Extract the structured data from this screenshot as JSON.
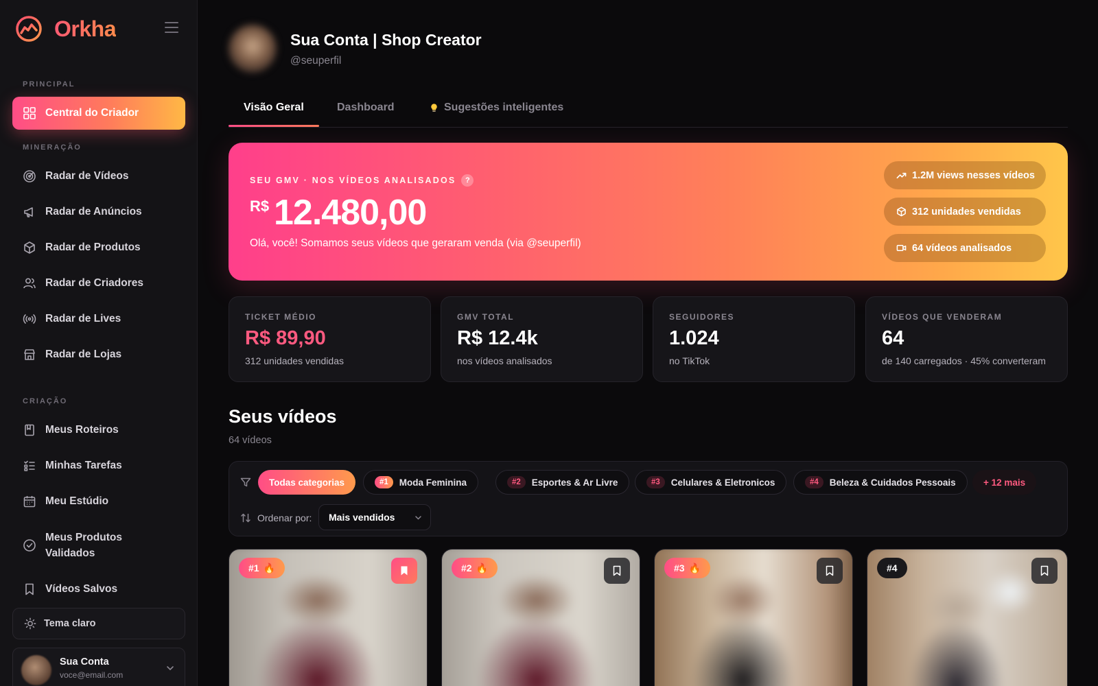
{
  "brand": {
    "name": "Orkha",
    "icon": "orkha-logo-icon"
  },
  "sidebar": {
    "sections": {
      "principal": "PRINCIPAL",
      "mineracao": "MINERAÇÃO",
      "criacao": "CRIAÇÃO"
    },
    "items": [
      {
        "label": "Central do Criador",
        "icon": "grid-icon",
        "active": true
      },
      {
        "label": "Radar de Vídeos",
        "icon": "radar-icon"
      },
      {
        "label": "Radar de Anúncios",
        "icon": "megaphone-icon"
      },
      {
        "label": "Radar de Produtos",
        "icon": "box-icon"
      },
      {
        "label": "Radar de Criadores",
        "icon": "users-icon"
      },
      {
        "label": "Radar de Lives",
        "icon": "broadcast-icon"
      },
      {
        "label": "Radar de Lojas",
        "icon": "store-icon"
      },
      {
        "label": "Meus Roteiros",
        "icon": "book-icon"
      },
      {
        "label": "Minhas Tarefas",
        "icon": "checklist-icon"
      },
      {
        "label": "Meu Estúdio",
        "icon": "calendar-icon"
      },
      {
        "label": "Meus Produtos Validados",
        "icon": "check-circle-icon"
      },
      {
        "label": "Vídeos Salvos",
        "icon": "bookmark-icon"
      }
    ],
    "theme_toggle": "Tema claro",
    "account": {
      "name": "Sua Conta",
      "email": "voce@email.com"
    }
  },
  "profile": {
    "name": "Sua Conta | Shop Creator",
    "handle": "@seuperfil"
  },
  "tabs": [
    {
      "label": "Visão Geral",
      "active": true
    },
    {
      "label": "Dashboard"
    },
    {
      "label": "Sugestões inteligentes",
      "icon": "lightbulb-icon"
    }
  ],
  "hero": {
    "kicker": "SEU GMV · NOS VÍDEOS ANALISADOS",
    "help": "?",
    "currency": "R$",
    "value": "12.480,00",
    "subtitle": "Olá, você! Somamos seus vídeos que geraram venda (via @seuperfil)",
    "pills": [
      {
        "label": "1.2M views nesses vídeos",
        "icon": "trending-up-icon"
      },
      {
        "label": "312 unidades vendidas",
        "icon": "box-icon"
      },
      {
        "label": "64 vídeos analisados",
        "icon": "video-icon"
      }
    ]
  },
  "stats": [
    {
      "label": "TICKET MÉDIO",
      "value": "R$ 89,90",
      "sub": "312 unidades vendidas",
      "accent": true
    },
    {
      "label": "GMV TOTAL",
      "value": "R$ 12.4k",
      "sub": "nos vídeos analisados"
    },
    {
      "label": "SEGUIDORES",
      "value": "1.024",
      "sub": "no TikTok"
    },
    {
      "label": "VÍDEOS QUE VENDERAM",
      "value": "64",
      "sub": "de 140 carregados · 45% converteram"
    }
  ],
  "videos": {
    "title": "Seus vídeos",
    "count": "64 vídeos",
    "filters": [
      {
        "label": "Todas categorias",
        "active": true
      },
      {
        "rank": "#1",
        "label": "Moda Feminina"
      },
      {
        "rank": "#2",
        "label": "Esportes & Ar Livre"
      },
      {
        "rank": "#3",
        "label": "Celulares & Eletronicos"
      },
      {
        "rank": "#4",
        "label": "Beleza & Cuidados Pessoais"
      }
    ],
    "more": "+ 12 mais",
    "sort_label": "Ordenar por:",
    "sort_value": "Mais vendidos",
    "cards": [
      {
        "rank": "#1",
        "saved": true
      },
      {
        "rank": "#2",
        "saved": false
      },
      {
        "rank": "#3",
        "saved": false
      },
      {
        "rank": "#4",
        "saved": false
      }
    ]
  },
  "colors": {
    "accent_pink": "#ff4d86",
    "accent_orange": "#ff9a4c",
    "accent_yellow": "#ffc64a",
    "background": "#0b0a0c",
    "panel": "#161519"
  }
}
